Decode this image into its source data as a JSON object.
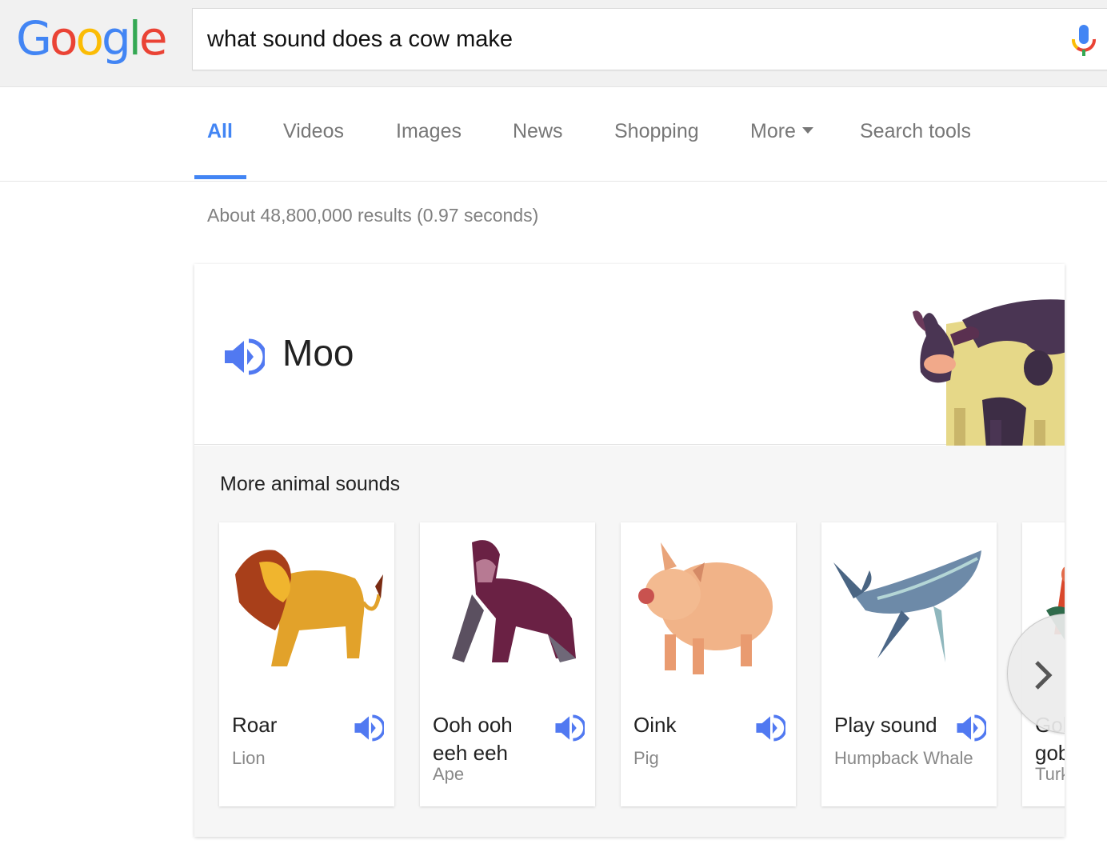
{
  "header": {
    "logo_letters": [
      {
        "char": "G",
        "color": "#4285f4"
      },
      {
        "char": "o",
        "color": "#ea4335"
      },
      {
        "char": "o",
        "color": "#fbbc05"
      },
      {
        "char": "g",
        "color": "#4285f4"
      },
      {
        "char": "l",
        "color": "#34a853"
      },
      {
        "char": "e",
        "color": "#ea4335"
      }
    ],
    "search_query": "what sound does a cow make",
    "mic_icon": "microphone-icon"
  },
  "tabs": [
    {
      "label": "All",
      "active": true
    },
    {
      "label": "Videos"
    },
    {
      "label": "Images"
    },
    {
      "label": "News"
    },
    {
      "label": "Shopping"
    },
    {
      "label": "More"
    },
    {
      "label": "Search tools"
    }
  ],
  "result_stats": "About 48,800,000 results (0.97 seconds)",
  "answer": {
    "sound": "Moo",
    "animal_image": "cow",
    "speaker_icon": "speaker-icon"
  },
  "more_sounds": {
    "title": "More animal sounds",
    "items": [
      {
        "sound": "Roar",
        "animal": "Lion"
      },
      {
        "sound": "Ooh ooh eeh eeh",
        "animal": "Ape"
      },
      {
        "sound": "Oink",
        "animal": "Pig"
      },
      {
        "sound": "Play sound",
        "animal": "Humpback Whale"
      },
      {
        "sound": "Gobble gobble",
        "animal": "Turkey",
        "visible_sound": "Go aob",
        "visible_animal": "Tur"
      }
    ],
    "next_icon": "chevron-right-icon"
  },
  "colors": {
    "accent": "#4285f4",
    "speaker": "#5179f1",
    "tab_text": "#777777"
  }
}
